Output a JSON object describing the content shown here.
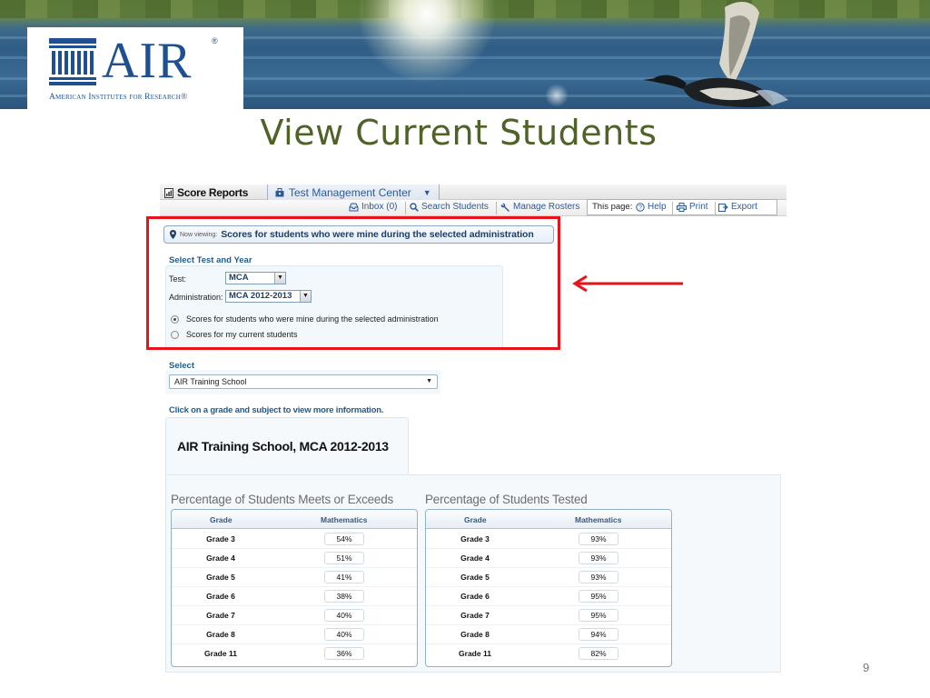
{
  "logo": {
    "name": "AIR",
    "registered": "®",
    "subtitle": "American Institutes for Research®"
  },
  "slide": {
    "title": "View Current Students",
    "page_number": "9"
  },
  "app": {
    "tabs": {
      "score_reports": "Score Reports",
      "test_management_center": "Test Management Center"
    },
    "toolbar": {
      "inbox": "Inbox (0)",
      "search_students": "Search Students",
      "manage_rosters": "Manage Rosters",
      "this_page": "This page:",
      "help": "Help",
      "print": "Print",
      "export": "Export"
    },
    "now_viewing": {
      "label": "Now viewing:",
      "value": "Scores for students who were mine during the selected administration"
    },
    "select_test": {
      "heading": "Select Test and Year",
      "test_label": "Test:",
      "test_value": "MCA",
      "admin_label": "Administration:",
      "admin_value": "MCA 2012-2013",
      "radio_1": "Scores for students who were mine during the selected administration",
      "radio_2": "Scores for my current students",
      "radio_selected": 1
    },
    "select_school": {
      "heading": "Select",
      "value": "AIR Training School"
    },
    "instruction": "Click on a grade and subject to view more information.",
    "report_title": "AIR Training School, MCA 2012-2013",
    "tables": [
      {
        "title": "Percentage of Students Meets or Exceeds",
        "columns": [
          "Grade",
          "Mathematics"
        ],
        "rows": [
          {
            "grade": "Grade 3",
            "value": "54%"
          },
          {
            "grade": "Grade 4",
            "value": "51%"
          },
          {
            "grade": "Grade 5",
            "value": "41%"
          },
          {
            "grade": "Grade 6",
            "value": "38%"
          },
          {
            "grade": "Grade 7",
            "value": "40%"
          },
          {
            "grade": "Grade 8",
            "value": "40%"
          },
          {
            "grade": "Grade 11",
            "value": "36%"
          }
        ]
      },
      {
        "title": "Percentage of Students Tested",
        "columns": [
          "Grade",
          "Mathematics"
        ],
        "rows": [
          {
            "grade": "Grade 3",
            "value": "93%"
          },
          {
            "grade": "Grade 4",
            "value": "93%"
          },
          {
            "grade": "Grade 5",
            "value": "93%"
          },
          {
            "grade": "Grade 6",
            "value": "95%"
          },
          {
            "grade": "Grade 7",
            "value": "95%"
          },
          {
            "grade": "Grade 8",
            "value": "94%"
          },
          {
            "grade": "Grade 11",
            "value": "82%"
          }
        ]
      }
    ]
  },
  "colors": {
    "title_green": "#4f6228",
    "air_blue": "#1d4f91",
    "highlight_red": "#e8121a",
    "link_blue": "#2a5a9a"
  }
}
